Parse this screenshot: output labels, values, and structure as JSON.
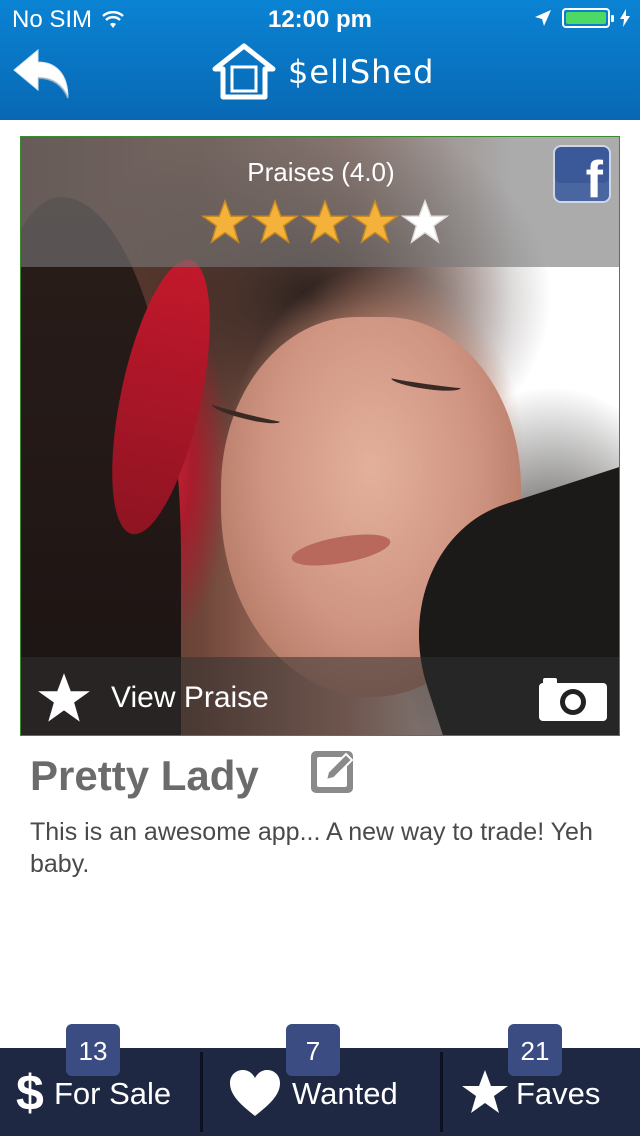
{
  "status_bar": {
    "carrier": "No SIM",
    "time": "12:00 pm"
  },
  "nav": {
    "app_name": "$ellShed",
    "logo_glyph": "$"
  },
  "praise": {
    "title": "Praises (4.0)",
    "rating": 4.0,
    "max_rating": 5,
    "star_color": "#f4b23a"
  },
  "photo": {
    "facebook_glyph": "f",
    "view_praise_label": "View Praise"
  },
  "item": {
    "title": "Pretty Lady",
    "description": "This is an awesome app... A new way to trade! Yeh baby."
  },
  "tabbar": {
    "tabs": [
      {
        "icon": "dollar-icon",
        "glyph": "$",
        "label": "For Sale",
        "count": "13"
      },
      {
        "icon": "heart-icon",
        "label": "Wanted",
        "count": "7"
      },
      {
        "icon": "star-icon",
        "label": "Faves",
        "count": "21"
      }
    ]
  },
  "colors": {
    "header_blue": "#0a83d3",
    "tabbar_navy": "#1f2842",
    "badge_blue": "#3a4c82",
    "facebook_blue": "#3b5998"
  }
}
